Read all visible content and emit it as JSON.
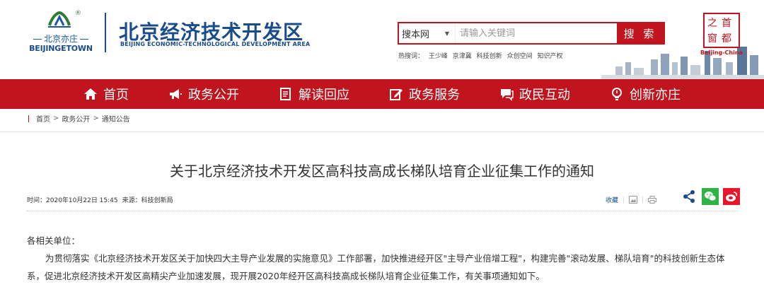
{
  "header": {
    "logo_cn": "北京亦庄",
    "logo_en": "BEIJINGETOWN",
    "logo_reg": "®",
    "site_title": "北京经济技术开发区",
    "site_subtitle": "BEIJING ECONOMIC-TECHNOLOGICAL DEVELOPMENT AREA",
    "capital_en": "Beijing-China",
    "capital_chars": [
      "首",
      "都",
      "之",
      "窗"
    ]
  },
  "search": {
    "scope": "搜本网",
    "placeholder": "请输入关键词",
    "button": "搜 索",
    "hot_label": "热搜词：",
    "hot_words": [
      "王少峰",
      "京津冀",
      "科技创新",
      "众创空间",
      "知识产权"
    ]
  },
  "nav": {
    "items": [
      {
        "label": "首页",
        "icon": "home-icon"
      },
      {
        "label": "政务公开",
        "icon": "megaphone-icon"
      },
      {
        "label": "解读回应",
        "icon": "document-icon"
      },
      {
        "label": "政务服务",
        "icon": "edit-icon"
      },
      {
        "label": "政民互动",
        "icon": "chat-icon"
      },
      {
        "label": "创新亦庄",
        "icon": "lightbulb-icon"
      }
    ]
  },
  "breadcrumb": {
    "items": [
      "首页",
      "政务公开",
      "通知公告"
    ],
    "separator": ">"
  },
  "article": {
    "title": "关于北京经济技术开发区高科技高成长梯队培育企业征集工作的通知",
    "time_label": "时间：",
    "time": "2020年10月22日 15:45",
    "source_label": "来源：",
    "source": "科技创新局",
    "favorite": "收藏",
    "salutation": "各相关单位：",
    "paragraph": "为贯彻落实《北京经济技术开发区关于加快四大主导产业发展的实施意见》工作部署，加快推进经开区\"主导产业倍增工程\"，构建完善\"滚动发展、梯队培育\"的科技创新生态体系，促进北京经济技术开发区高精尖产业加速发展，现开展2020年经开区高科技高成长梯队培育企业征集工作，有关事项通知如下。"
  },
  "colors": {
    "brand_red": "#c0141e",
    "brand_blue": "#1a4c8c",
    "wechat_green": "#2fb344",
    "weibo_red": "#e6162d"
  }
}
